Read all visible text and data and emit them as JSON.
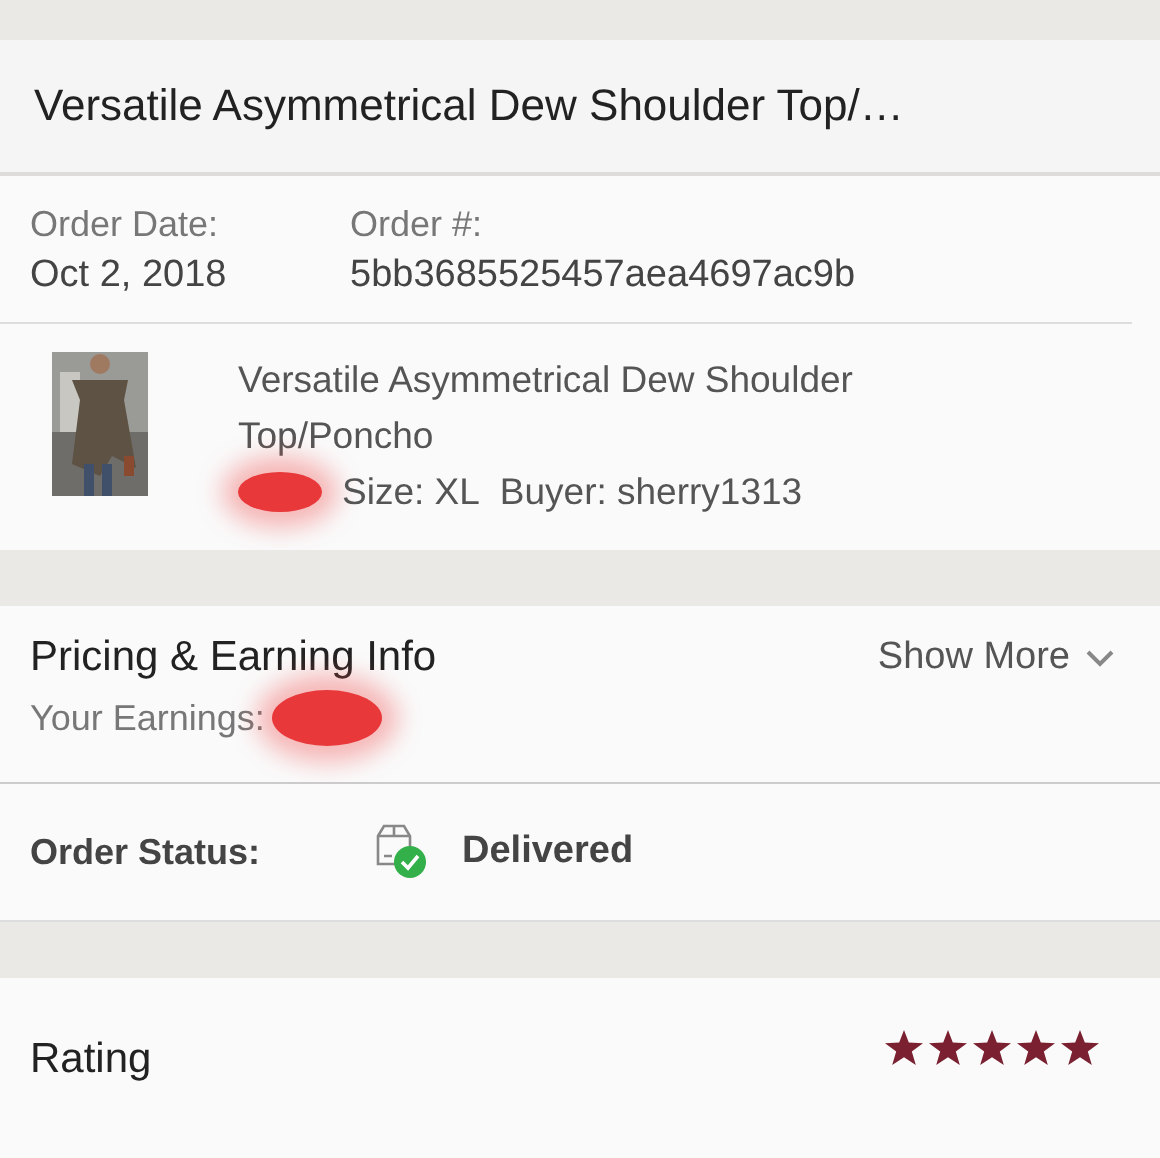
{
  "header": {
    "title": "Versatile Asymmetrical Dew Shoulder Top/…"
  },
  "order": {
    "date_label": "Order Date:",
    "date": "Oct 2, 2018",
    "number_label": "Order #:",
    "number": "5bb3685525457aea4697ac9b"
  },
  "item": {
    "title": "Versatile Asymmetrical Dew Shoulder Top/Poncho",
    "size": "Size: XL",
    "buyer": "Buyer: sherry1313"
  },
  "pricing": {
    "title": "Pricing & Earning Info",
    "earnings_label": "Your Earnings:",
    "toggle": "Show More"
  },
  "status": {
    "label": "Order Status:",
    "value": "Delivered"
  },
  "rating": {
    "label": "Rating",
    "stars": 5
  }
}
